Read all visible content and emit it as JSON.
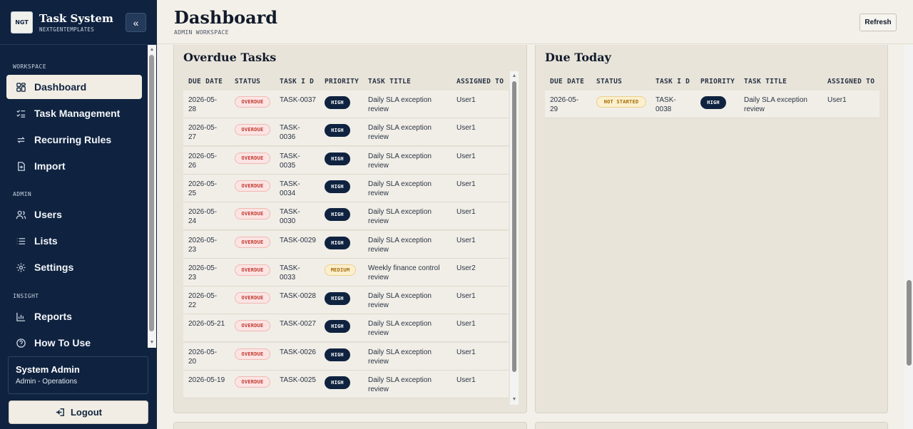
{
  "brand": {
    "logo_text": "NGT",
    "title": "Task System",
    "subtitle": "NEXTGENTEMPLATES"
  },
  "sidebar": {
    "sections": {
      "workspace": "WORKSPACE",
      "admin": "ADMIN",
      "insight": "INSIGHT"
    },
    "items": [
      {
        "label": "Dashboard",
        "icon": "grid-icon",
        "active": true
      },
      {
        "label": "Task Management",
        "icon": "checklist-icon"
      },
      {
        "label": "Recurring Rules",
        "icon": "repeat-icon"
      },
      {
        "label": "Import",
        "icon": "file-import-icon"
      },
      {
        "label": "Users",
        "icon": "users-icon"
      },
      {
        "label": "Lists",
        "icon": "list-icon"
      },
      {
        "label": "Settings",
        "icon": "gear-icon"
      },
      {
        "label": "Reports",
        "icon": "bar-chart-icon"
      },
      {
        "label": "How To Use",
        "icon": "help-icon"
      }
    ],
    "user": {
      "name": "System Admin",
      "role": "Admin - Operations"
    },
    "logout_label": "Logout"
  },
  "header": {
    "title": "Dashboard",
    "subtitle": "ADMIN WORKSPACE",
    "refresh_label": "Refresh"
  },
  "overdue": {
    "title": "Overdue Tasks",
    "columns": [
      "DUE DATE",
      "STATUS",
      "TASK I D",
      "PRIORITY",
      "TASK TITLE",
      "ASSIGNED TO"
    ],
    "rows": [
      {
        "date": "2026-05-\n28",
        "status": "OVERDUE",
        "id": "TASK-0037",
        "priority": "HIGH",
        "title": "Daily SLA exception\nreview",
        "assigned": "User1"
      },
      {
        "date": "2026-05-\n27",
        "status": "OVERDUE",
        "id": "TASK-\n0036",
        "priority": "HIGH",
        "title": "Daily SLA exception\nreview",
        "assigned": "User1"
      },
      {
        "date": "2026-05-\n26",
        "status": "OVERDUE",
        "id": "TASK-\n0035",
        "priority": "HIGH",
        "title": "Daily SLA exception\nreview",
        "assigned": "User1"
      },
      {
        "date": "2026-05-\n25",
        "status": "OVERDUE",
        "id": "TASK-\n0034",
        "priority": "HIGH",
        "title": "Daily SLA exception\nreview",
        "assigned": "User1"
      },
      {
        "date": "2026-05-\n24",
        "status": "OVERDUE",
        "id": "TASK-\n0030",
        "priority": "HIGH",
        "title": "Daily SLA exception\nreview",
        "assigned": "User1"
      },
      {
        "date": "2026-05-\n23",
        "status": "OVERDUE",
        "id": "TASK-0029",
        "priority": "HIGH",
        "title": "Daily SLA exception\nreview",
        "assigned": "User1"
      },
      {
        "date": "2026-05-\n23",
        "status": "OVERDUE",
        "id": "TASK-\n0033",
        "priority": "MEDIUM",
        "title": "Weekly finance control\nreview",
        "assigned": "User2"
      },
      {
        "date": "2026-05-\n22",
        "status": "OVERDUE",
        "id": "TASK-0028",
        "priority": "HIGH",
        "title": "Daily SLA exception\nreview",
        "assigned": "User1"
      },
      {
        "date": "2026-05-21",
        "status": "OVERDUE",
        "id": "TASK-0027",
        "priority": "HIGH",
        "title": "Daily SLA exception\nreview",
        "assigned": "User1"
      },
      {
        "date": "2026-05-\n20",
        "status": "OVERDUE",
        "id": "TASK-0026",
        "priority": "HIGH",
        "title": "Daily SLA exception\nreview",
        "assigned": "User1"
      },
      {
        "date": "2026-05-19",
        "status": "OVERDUE",
        "id": "TASK-0025",
        "priority": "HIGH",
        "title": "Daily SLA exception\nreview",
        "assigned": "User1"
      }
    ]
  },
  "due_today": {
    "title": "Due Today",
    "columns": [
      "DUE DATE",
      "STATUS",
      "TASK I D",
      "PRIORITY",
      "TASK TITLE",
      "ASSIGNED TO"
    ],
    "rows": [
      {
        "date": "2026-05-\n29",
        "status": "NOT STARTED",
        "id": "TASK-\n0038",
        "priority": "HIGH",
        "title": "Daily SLA exception\nreview",
        "assigned": "User1"
      }
    ]
  },
  "colors": {
    "sidebar_bg": "#0f2340",
    "page_bg": "#f3f0e9",
    "panel_bg": "#e8e4da",
    "overdue": "#c2362f",
    "warning": "#a46a06"
  }
}
